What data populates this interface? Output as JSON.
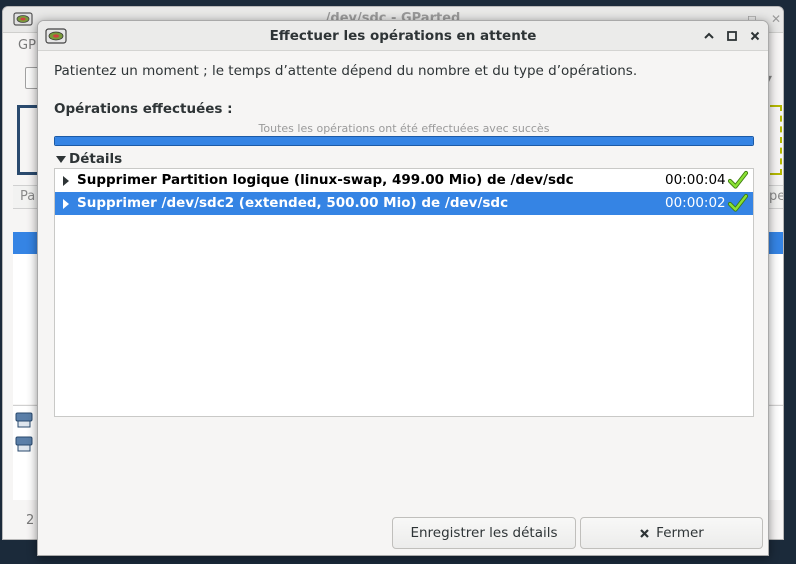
{
  "background_window": {
    "title": "/dev/sdc - GParted",
    "menu_label": "GP",
    "list_header_left": "Pa",
    "list_header_right": "pe",
    "status_text": "2"
  },
  "dialog": {
    "title": "Effectuer les opérations en attente",
    "intro": "Patientez un moment ; le temps d’attente dépend du nombre et du type d’opérations.",
    "completed_label": "Opérations effectuées :",
    "progress": {
      "text": "Toutes les opérations ont été effectuées avec succès",
      "fraction": 1.0
    },
    "details_label": "Détails",
    "operations": [
      {
        "label": "Supprimer Partition logique (linux-swap, 499.00 Mio) de /dev/sdc",
        "time": "00:00:04",
        "status_icon": "success-check-icon",
        "selected": false
      },
      {
        "label": "Supprimer /dev/sdc2 (extended, 500.00 Mio) de /dev/sdc",
        "time": "00:00:02",
        "status_icon": "success-check-icon",
        "selected": true
      }
    ],
    "buttons": {
      "save_details": "Enregistrer les détails",
      "close": "Fermer"
    }
  },
  "colors": {
    "accent": "#3584e4",
    "success": "#73d216"
  }
}
